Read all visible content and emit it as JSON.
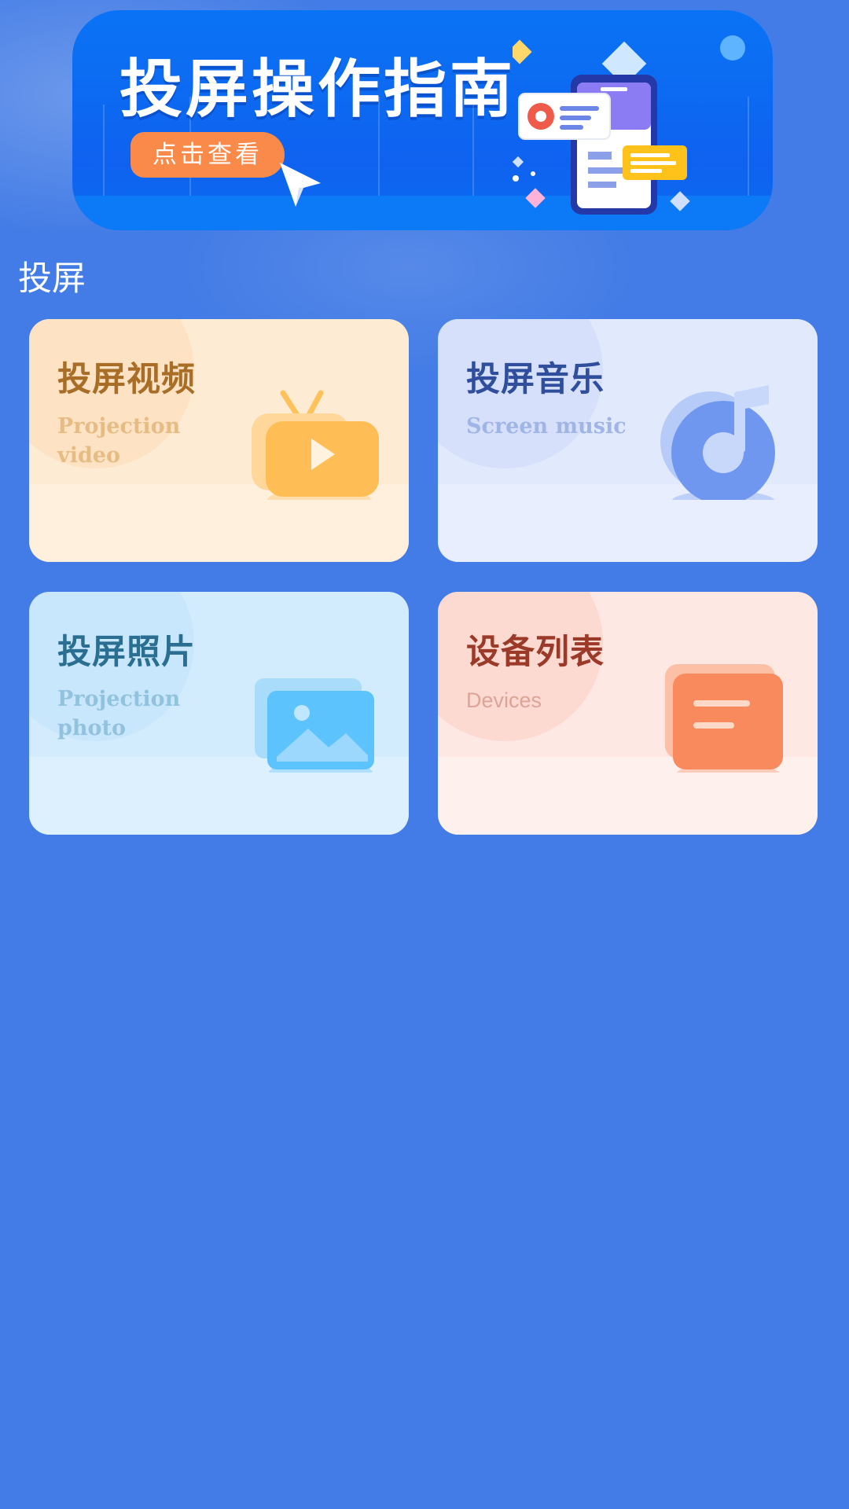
{
  "banner": {
    "title": "投屏操作指南",
    "cta_label": "点击查看"
  },
  "section": {
    "title": "投屏"
  },
  "cards": [
    {
      "title_cn": "投屏视频",
      "title_en": "Projection video",
      "icon": "tv-play-icon"
    },
    {
      "title_cn": "投屏音乐",
      "title_en": "Screen music",
      "icon": "music-note-icon"
    },
    {
      "title_cn": "投屏照片",
      "title_en": "Projection photo",
      "icon": "photo-icon"
    },
    {
      "title_cn": "设备列表",
      "title_en": "Devices",
      "icon": "device-list-icon"
    }
  ],
  "colors": {
    "background": "#437ce6",
    "banner": "#0f62ef",
    "cta": "#fa8a4a",
    "video_card": "#fdebd4",
    "music_card": "#e1e9fd",
    "photo_card": "#d2ecfd",
    "devices_card": "#fde8e3"
  }
}
